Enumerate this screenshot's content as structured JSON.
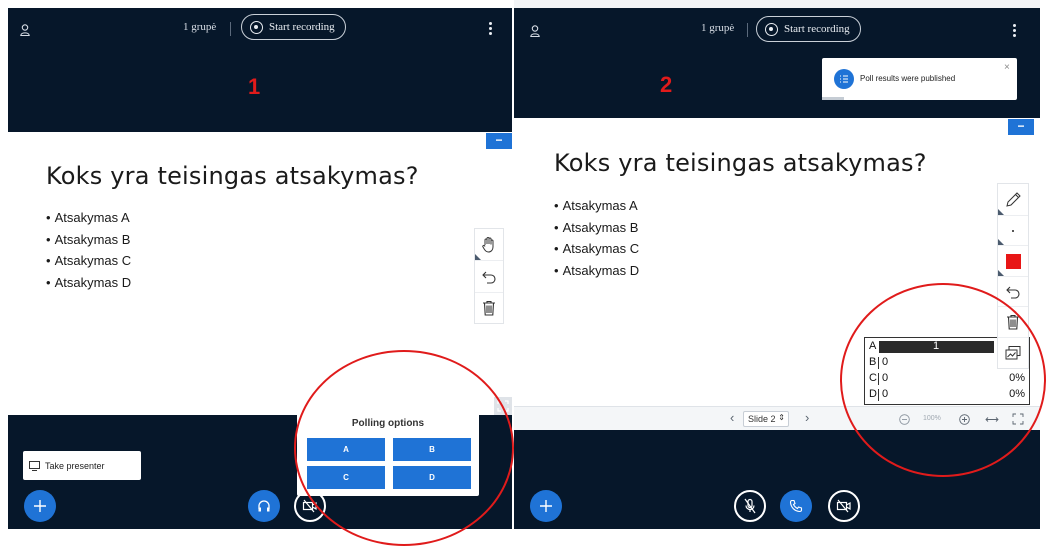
{
  "screens": [
    {
      "number_label": "1",
      "group_label": "1 grupė",
      "record_label": "Start recording",
      "slide": {
        "title": "Koks yra teisingas atsakymas?",
        "bullets": [
          "Atsakymas A",
          "Atsakymas B",
          "Atsakymas C",
          "Atsakymas D"
        ]
      },
      "tools": [
        "hand-icon",
        "undo-icon",
        "trash-icon"
      ],
      "polling": {
        "title": "Polling options",
        "options": [
          "A",
          "B",
          "C",
          "D"
        ]
      },
      "take_presenter_label": "Take presenter",
      "bottom_buttons": [
        "plus-icon",
        "headphones-icon",
        "camera-off-icon"
      ]
    },
    {
      "number_label": "2",
      "group_label": "1 grupė",
      "record_label": "Start recording",
      "notification": "Poll results were published",
      "slide": {
        "title": "Koks yra teisingas atsakymas?",
        "bullets": [
          "Atsakymas A",
          "Atsakymas B",
          "Atsakymas C",
          "Atsakymas D"
        ]
      },
      "tools": [
        "pencil-icon",
        "dot-icon",
        "color-icon",
        "undo-icon",
        "trash-icon",
        "multi-user-icon"
      ],
      "results": [
        {
          "letter": "A",
          "count": "1",
          "percent": ""
        },
        {
          "letter": "B",
          "count": "0",
          "percent": "0%"
        },
        {
          "letter": "C",
          "count": "0",
          "percent": "0%"
        },
        {
          "letter": "D",
          "count": "0",
          "percent": "0%"
        }
      ],
      "slide_nav": {
        "slide_select": "Slide 2",
        "zoom": "100%"
      },
      "bottom_buttons": [
        "plus-icon",
        "mic-off-icon",
        "phone-icon",
        "camera-off-icon"
      ]
    }
  ],
  "colors": {
    "background_dark": "#06172a",
    "accent_blue": "#1f73d6",
    "annotation_red": "#e01b1b",
    "pen_color": "#e81616"
  }
}
